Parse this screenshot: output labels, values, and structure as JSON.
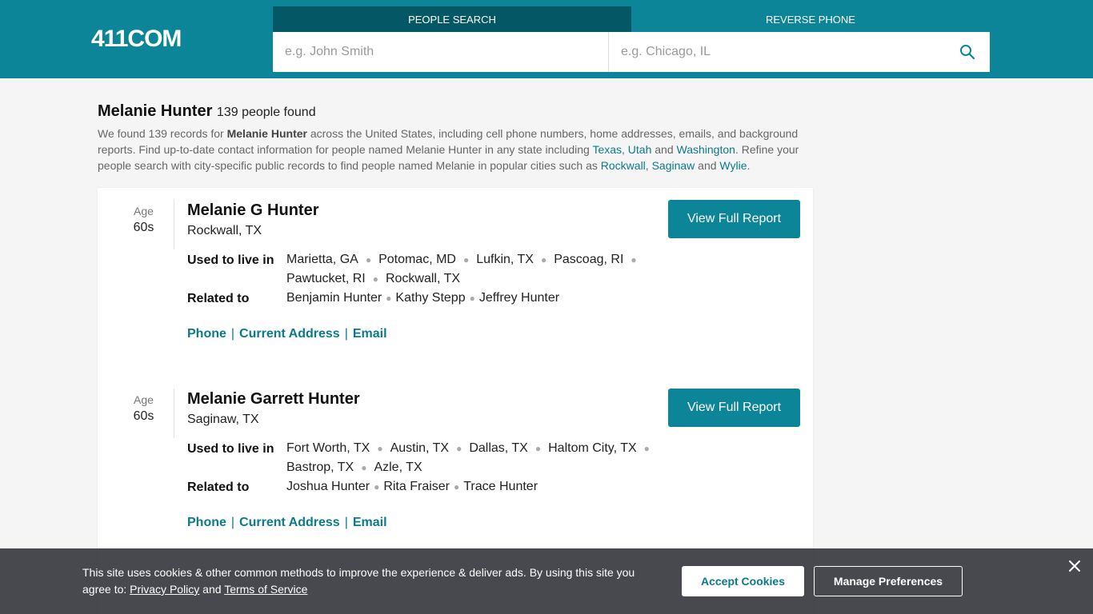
{
  "header": {
    "logo": "411COM",
    "tabs": [
      {
        "label": "PEOPLE SEARCH",
        "active": true
      },
      {
        "label": "REVERSE PHONE",
        "active": false
      }
    ],
    "name_placeholder": "e.g. John Smith",
    "location_placeholder": "e.g. Chicago, IL",
    "search_icon": "search-icon"
  },
  "intro": {
    "name": "Melanie Hunter",
    "count": "139 people found",
    "p1": "We found 139 records for ",
    "bold_name": "Melanie Hunter",
    "p2": " across the United States, including cell phone numbers, home addresses, emails, and background reports. Find up-to-date contact information for people named Melanie Hunter in any state including ",
    "state1": "Texas",
    "comma": ", ",
    "state2": "Utah",
    "and1": " and ",
    "state3": "Washington",
    "p3": ". Refine your people search with city-specific public records to find people named Melanie in popular cities such as ",
    "city1": "Rockwall",
    "city2": "Saginaw",
    "and2": " and ",
    "city3": "Wylie",
    "period": "."
  },
  "labels": {
    "age": "Age",
    "used_to_live": "Used to live in",
    "related_to": "Related to",
    "view_report": "View Full Report",
    "phone": "Phone",
    "address": "Current Address",
    "email": "Email",
    "sep": "|"
  },
  "results": [
    {
      "age": "60s",
      "name": "Melanie G Hunter",
      "location": "Rockwall, TX",
      "lived": [
        "Marietta, GA",
        "Potomac, MD",
        "Lufkin, TX",
        "Pascoag, RI",
        "Pawtucket, RI",
        "Rockwall, TX"
      ],
      "related": [
        "Benjamin Hunter",
        "Kathy Stepp",
        "Jeffrey Hunter"
      ]
    },
    {
      "age": "60s",
      "name": "Melanie Garrett Hunter",
      "location": "Saginaw, TX",
      "lived": [
        "Fort Worth, TX",
        "Austin, TX",
        "Dallas, TX",
        "Haltom City, TX",
        "Bastrop, TX",
        "Azle, TX"
      ],
      "related": [
        "Joshua Hunter",
        "Rita Fraiser",
        "Trace Hunter"
      ]
    }
  ],
  "cookie": {
    "text1": "This site uses cookies & other common methods to improve the experience & deliver ads. By using this site you agree to: ",
    "privacy": "Privacy Policy",
    "and": " and ",
    "terms": "Terms of Service",
    "accept": "Accept Cookies",
    "manage": "Manage Preferences",
    "close_icon": "close-icon"
  },
  "colors": {
    "brand": "#0b8597",
    "tab_active": "#045866",
    "link": "#0b7a8a"
  }
}
